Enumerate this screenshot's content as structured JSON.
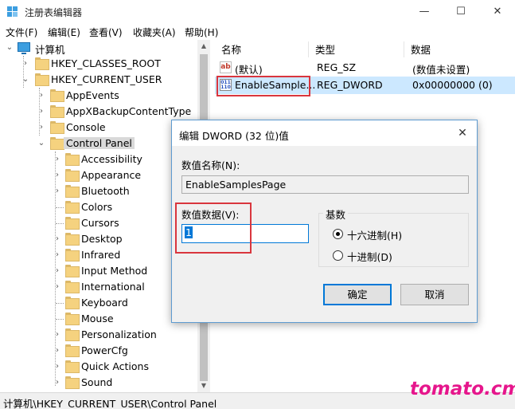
{
  "window": {
    "title": "注册表编辑器",
    "minimize": "—",
    "maximize": "☐",
    "close": "✕"
  },
  "menu": [
    "文件(F)",
    "编辑(E)",
    "查看(V)",
    "收藏夹(A)",
    "帮助(H)"
  ],
  "tree": {
    "root": "计算机",
    "hkcr": "HKEY_CLASSES_ROOT",
    "hkcu": "HKEY_CURRENT_USER",
    "hkcu_children": [
      "AppEvents",
      "AppXBackupContentType",
      "Console",
      "Control Panel"
    ],
    "control_panel_children": [
      "Accessibility",
      "Appearance",
      "Bluetooth",
      "Colors",
      "Cursors",
      "Desktop",
      "Infrared",
      "Input Method",
      "International",
      "Keyboard",
      "Mouse",
      "Personalization",
      "PowerCfg",
      "Quick Actions",
      "Sound"
    ]
  },
  "list": {
    "headers": {
      "name": "名称",
      "type": "类型",
      "data": "数据"
    },
    "rows": [
      {
        "name": "(默认)",
        "type": "REG_SZ",
        "data": "(数值未设置)",
        "icon": "ab-string-icon"
      },
      {
        "name": "EnableSample...",
        "type": "REG_DWORD",
        "data": "0x00000000 (0)",
        "icon": "binary-value-icon"
      }
    ]
  },
  "status": {
    "path": "计算机\\HKEY_CURRENT_USER\\Control Panel"
  },
  "watermark": "tomato.cm",
  "dialog": {
    "title": "编辑 DWORD (32 位)值",
    "close": "✕",
    "name_label": "数值名称(N):",
    "name_value": "EnableSamplesPage",
    "data_label": "数值数据(V):",
    "data_value": "1",
    "base_label": "基数",
    "hex_label": "十六进制(H)",
    "dec_label": "十进制(D)",
    "ok": "确定",
    "cancel": "取消"
  },
  "colors": {
    "accent": "#0078d7",
    "highlight_box": "#d9363e",
    "selected_row": "#cce8ff",
    "watermark": "#e6168c"
  }
}
